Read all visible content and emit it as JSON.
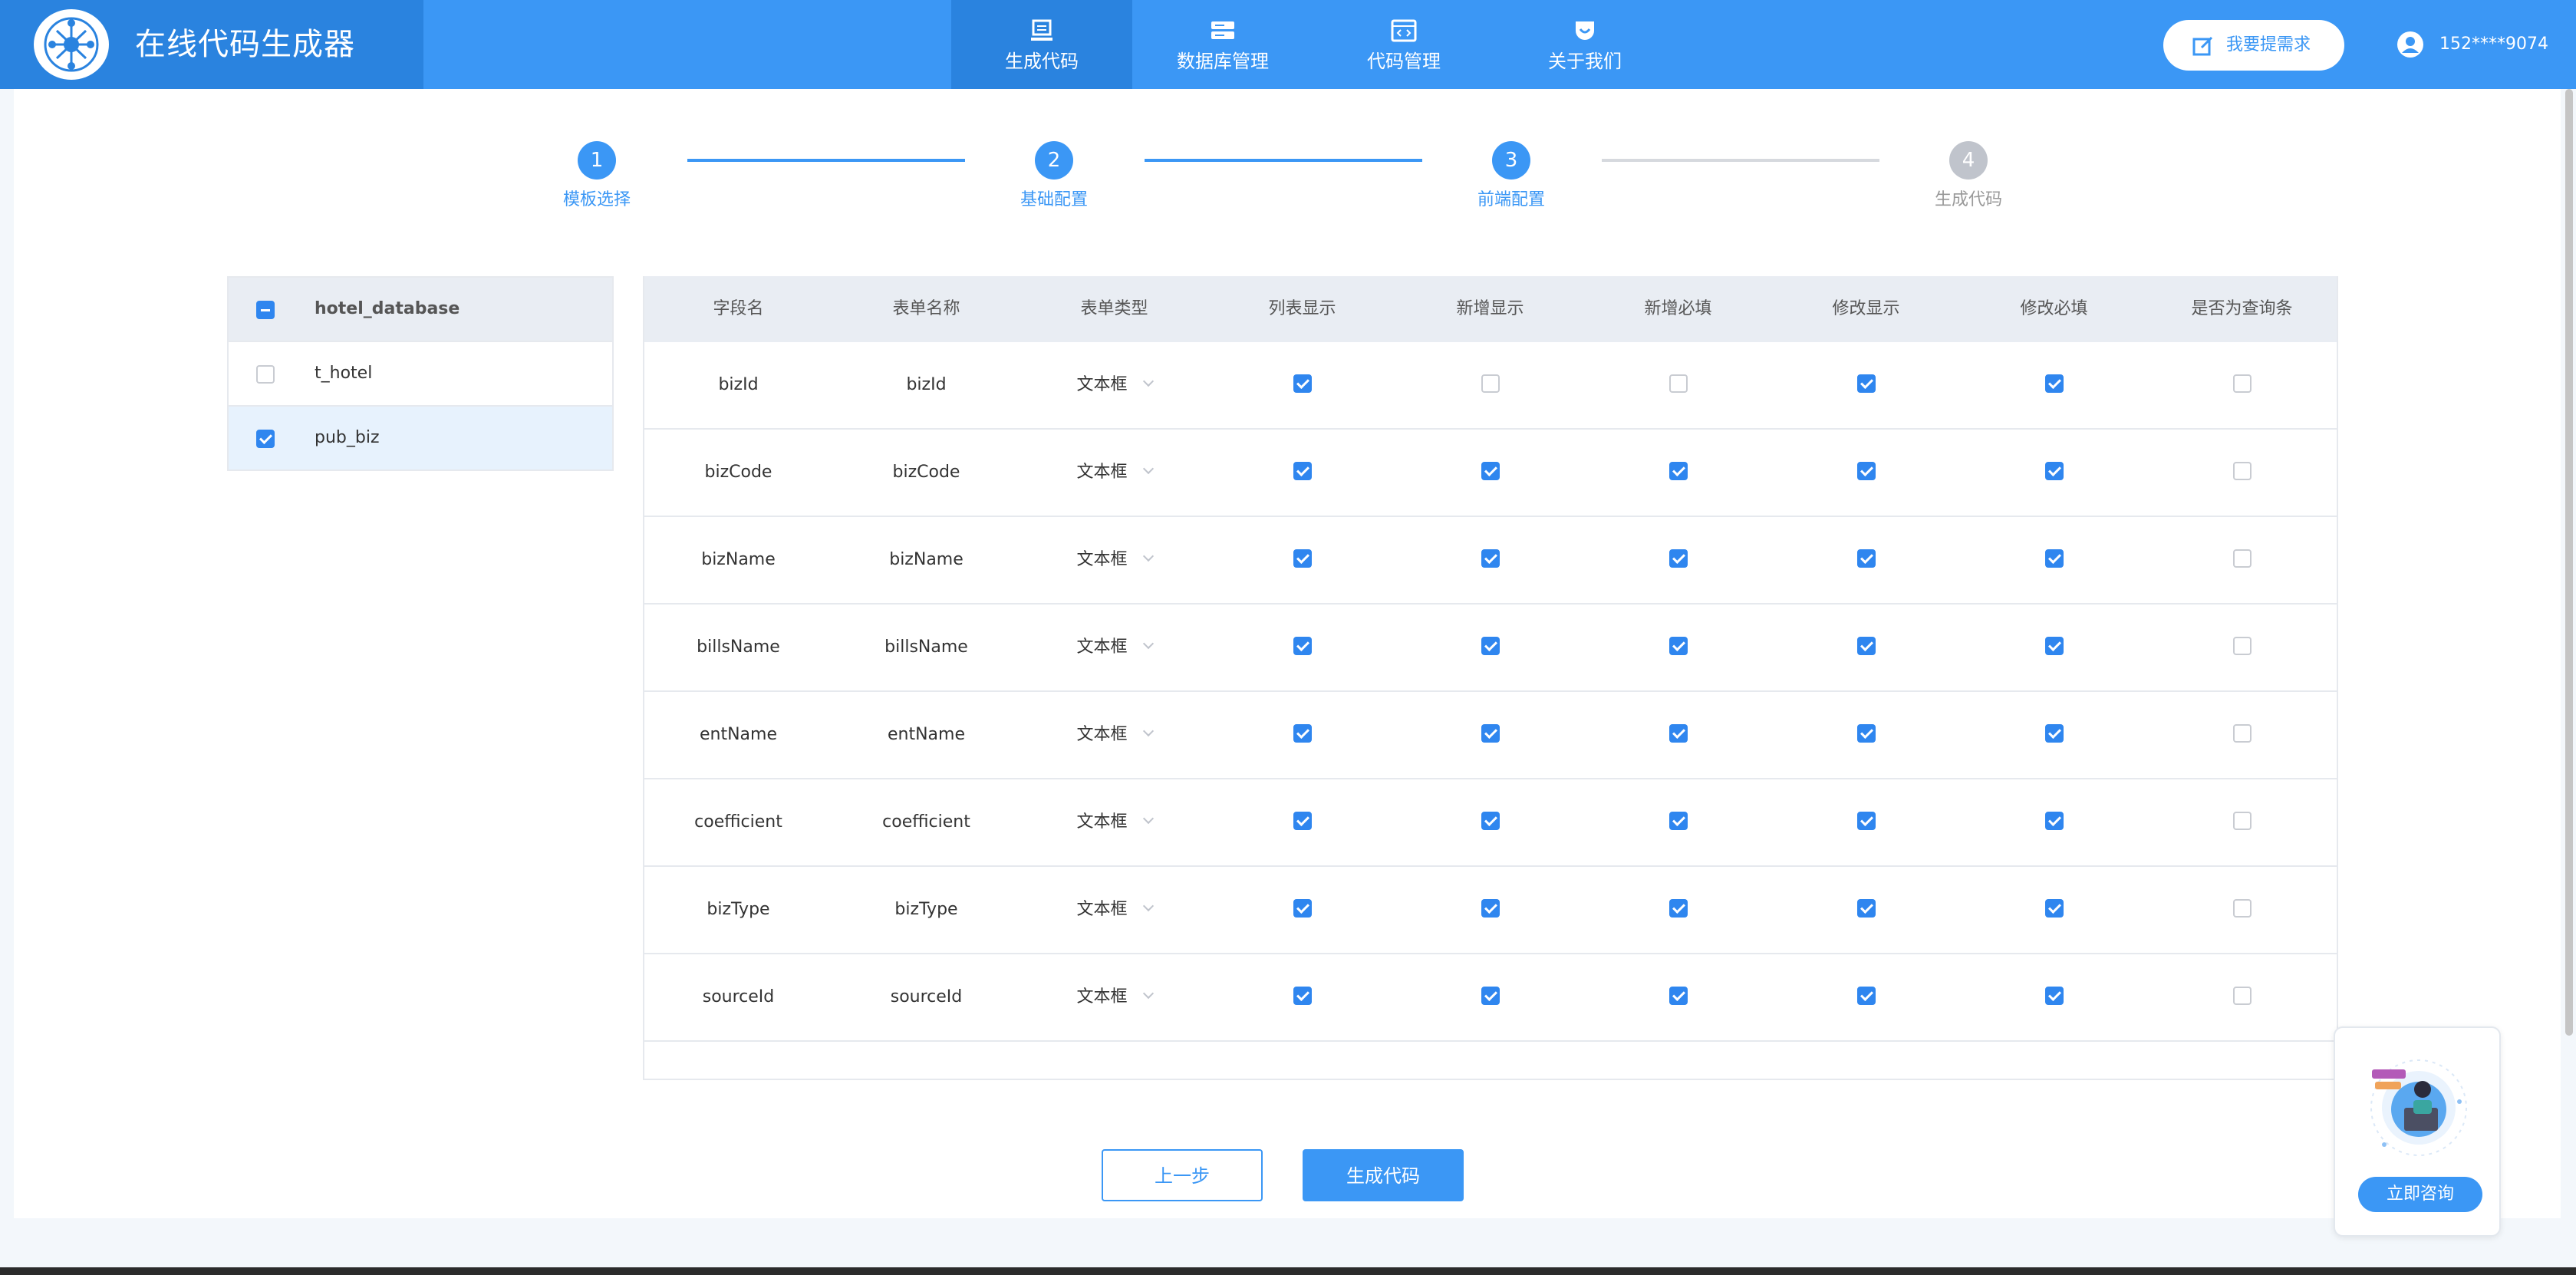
{
  "brand": {
    "title": "在线代码生成器"
  },
  "nav": [
    {
      "label": "生成代码",
      "icon": "monitor-icon",
      "active": true
    },
    {
      "label": "数据库管理",
      "icon": "database-icon",
      "active": false
    },
    {
      "label": "代码管理",
      "icon": "code-window-icon",
      "active": false
    },
    {
      "label": "关于我们",
      "icon": "chat-bubble-icon",
      "active": false
    }
  ],
  "header": {
    "request_label": "我要提需求",
    "user_name": "152****9074"
  },
  "steps": [
    {
      "num": "1",
      "label": "模板选择",
      "done": true
    },
    {
      "num": "2",
      "label": "基础配置",
      "done": true
    },
    {
      "num": "3",
      "label": "前端配置",
      "done": true
    },
    {
      "num": "4",
      "label": "生成代码",
      "done": false
    }
  ],
  "tree": {
    "database": "hotel_database",
    "tables": [
      {
        "name": "t_hotel",
        "checked": false
      },
      {
        "name": "pub_biz",
        "checked": true
      }
    ]
  },
  "table": {
    "columns": [
      "字段名",
      "表单名称",
      "表单类型",
      "列表显示",
      "新增显示",
      "新增必填",
      "修改显示",
      "修改必填",
      "是否为查询条"
    ],
    "rows": [
      {
        "field": "bizId",
        "form_name": "bizId",
        "form_type": "文本框",
        "flags": [
          true,
          false,
          false,
          true,
          true,
          false
        ]
      },
      {
        "field": "bizCode",
        "form_name": "bizCode",
        "form_type": "文本框",
        "flags": [
          true,
          true,
          true,
          true,
          true,
          false
        ]
      },
      {
        "field": "bizName",
        "form_name": "bizName",
        "form_type": "文本框",
        "flags": [
          true,
          true,
          true,
          true,
          true,
          false
        ]
      },
      {
        "field": "billsName",
        "form_name": "billsName",
        "form_type": "文本框",
        "flags": [
          true,
          true,
          true,
          true,
          true,
          false
        ]
      },
      {
        "field": "entName",
        "form_name": "entName",
        "form_type": "文本框",
        "flags": [
          true,
          true,
          true,
          true,
          true,
          false
        ]
      },
      {
        "field": "coefficient",
        "form_name": "coefficient",
        "form_type": "文本框",
        "flags": [
          true,
          true,
          true,
          true,
          true,
          false
        ]
      },
      {
        "field": "bizType",
        "form_name": "bizType",
        "form_type": "文本框",
        "flags": [
          true,
          true,
          true,
          true,
          true,
          false
        ]
      },
      {
        "field": "sourceId",
        "form_name": "sourceId",
        "form_type": "文本框",
        "flags": [
          true,
          true,
          true,
          true,
          true,
          false
        ]
      }
    ]
  },
  "actions": {
    "prev_label": "上一步",
    "generate_label": "生成代码"
  },
  "consult": {
    "button_label": "立即咨询"
  },
  "colors": {
    "primary": "#3b97f5",
    "primary_dark": "#2a83df",
    "checkbox": "#2f86ef"
  }
}
